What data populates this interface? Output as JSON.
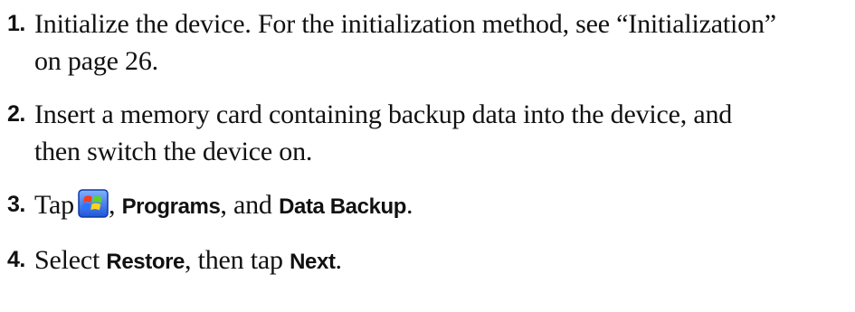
{
  "steps": [
    {
      "number": "1.",
      "line1": "Initialize the device. For the initialization method, see “Initialization”",
      "line2": "on page 26."
    },
    {
      "number": "2.",
      "line1": "Insert a memory card containing backup data into the device, and",
      "line2": "then switch the device on."
    },
    {
      "number": "3.",
      "text_tap": "Tap",
      "icon": "windows-start-icon",
      "sep1": ",",
      "bold1": "Programs",
      "text_and": ", and",
      "bold2": "Data Backup",
      "period": "."
    },
    {
      "number": "4.",
      "text_select": "Select",
      "bold1": "Restore",
      "text_then": ", then tap",
      "bold2": "Next",
      "period": "."
    }
  ]
}
